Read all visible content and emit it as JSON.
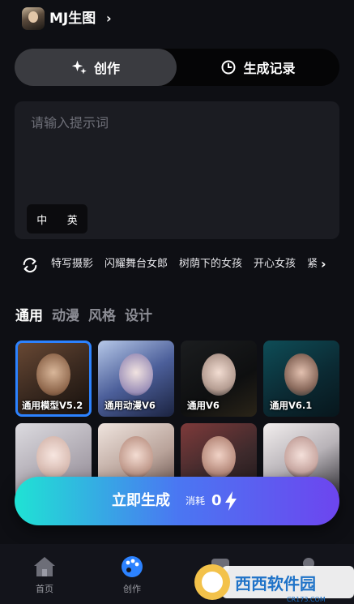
{
  "header": {
    "title": "MJ生图",
    "chevron": "›"
  },
  "mode_tabs": [
    {
      "label": "创作",
      "icon": "sparkles-icon",
      "active": true
    },
    {
      "label": "生成记录",
      "icon": "clock-icon",
      "active": false
    }
  ],
  "prompt": {
    "placeholder": "请输入提示词",
    "value": "",
    "lang_options": [
      "中",
      "英"
    ]
  },
  "suggestions": [
    "特写摄影",
    "闪耀舞台女郎",
    "树荫下的女孩",
    "开心女孩",
    "紧"
  ],
  "categories": [
    {
      "label": "通用",
      "active": true
    },
    {
      "label": "动漫",
      "active": false
    },
    {
      "label": "风格",
      "active": false
    },
    {
      "label": "设计",
      "active": false
    }
  ],
  "models": [
    {
      "label": "通用模型V5.2",
      "selected": true
    },
    {
      "label": "通用动漫V6",
      "selected": false
    },
    {
      "label": "通用V6",
      "selected": false
    },
    {
      "label": "通用V6.1",
      "selected": false
    },
    {
      "label": "",
      "selected": false
    },
    {
      "label": "",
      "selected": false
    },
    {
      "label": "",
      "selected": false
    },
    {
      "label": "",
      "selected": false
    }
  ],
  "generate": {
    "label": "立即生成",
    "cost_label": "消耗",
    "cost": "0"
  },
  "bottom_nav": [
    {
      "label": "首页",
      "icon": "home-icon",
      "active": false
    },
    {
      "label": "创作",
      "icon": "palette-icon",
      "active": true
    },
    {
      "label": "",
      "icon": "chat-icon",
      "active": false
    },
    {
      "label": "",
      "icon": "profile-icon",
      "active": false
    }
  ],
  "watermark": {
    "text": "西西软件园",
    "sub": "CR173.COM"
  },
  "colors": {
    "background": "#0e0f14",
    "accent_blue": "#2c82ff",
    "gradient_start": "#1fe3d4",
    "gradient_end": "#6d45ef"
  }
}
